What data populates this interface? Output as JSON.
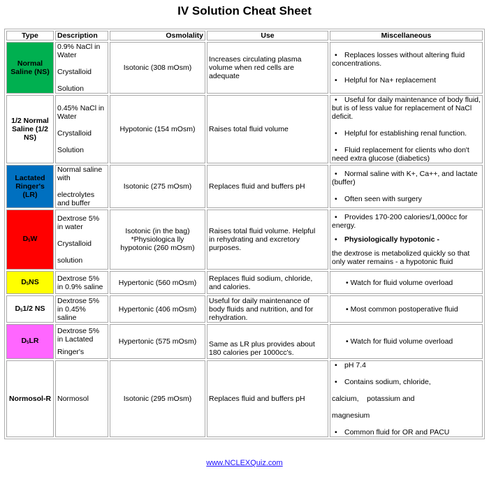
{
  "title": "IV Solution Cheat Sheet",
  "headers": {
    "type": "Type",
    "description": "Description",
    "osmolality": "Osmolality",
    "use": "Use",
    "misc": "Miscellaneous"
  },
  "colors": {
    "ns": "#00b050",
    "lr": "#0070c0",
    "d5w": "#ff0000",
    "d5ns": "#ffff00",
    "d5lr": "#ff66ff",
    "link": "#1a0dff"
  },
  "rows": [
    {
      "type": "Normal Saline (NS)",
      "description": [
        "0.9% NaCl in Water",
        "Crystalloid",
        "Solution"
      ],
      "osmolality": "Isotonic (308 mOsm)",
      "use": "Increases circulating plasma volume when red cells are adequate",
      "misc": [
        "Replaces losses without altering fluid concentrations.",
        "Helpful for Na+ replacement"
      ]
    },
    {
      "type": "1/2 Normal Saline (1/2 NS)",
      "description": [
        "0.45% NaCl in Water",
        "Crystalloid",
        "Solution"
      ],
      "osmolality": "Hypotonic (154 mOsm)",
      "use": "Raises total fluid volume",
      "misc": [
        "Useful for daily maintenance of body fluid, but is of less value for replacement of NaCl deficit.",
        "Helpful for establishing renal function.",
        "Fluid replacement for clients who don't need extra glucose (diabetics)"
      ]
    },
    {
      "type": "Lactated Ringer's (LR)",
      "description": [
        "Normal saline with",
        "electrolytes and buffer"
      ],
      "osmolality": "Isotonic (275 mOsm)",
      "use": "Replaces fluid and buffers pH",
      "misc": [
        "Normal saline with K+, Ca++, and lactate (buffer)",
        "Often seen with surgery"
      ]
    },
    {
      "type_prefix": "D",
      "type_sub": "5",
      "type_suffix": "W",
      "description": [
        "Dextrose 5% in water",
        "Crystalloid",
        "solution"
      ],
      "osmolality": "Isotonic (in the bag) *Physiologica lly hypotonic (260 mOsm)",
      "use": "Raises total fluid volume. Helpful in rehydrating and excretory purposes.",
      "misc": [
        "Provides 170-200 calories/1,000cc for energy.",
        "Physiologically hypotonic -",
        "the dextrose is metabolized quickly so that only water remains - a hypotonic fluid"
      ]
    },
    {
      "type_prefix": "D",
      "type_sub": "5",
      "type_suffix": "NS",
      "description": [
        "Dextrose 5% in 0.9% saline"
      ],
      "osmolality": "Hypertonic (560 mOsm)",
      "use": "Replaces fluid sodium, chloride, and calories.",
      "misc": [
        "• Watch for fluid volume overload"
      ]
    },
    {
      "type_prefix": "D",
      "type_sub": "5",
      "type_suffix": "1/2 NS",
      "description": [
        "Dextrose 5% in 0.45% saline"
      ],
      "osmolality": "Hypertonic (406 mOsm)",
      "use": "Useful for daily maintenance of body fluids and nutrition, and for rehydration.",
      "misc": [
        "• Most common postoperative fluid"
      ]
    },
    {
      "type_prefix": "D",
      "type_sub": "5",
      "type_suffix": "LR",
      "description": [
        "Dextrose 5% in Lactated",
        "Ringer's"
      ],
      "osmolality": "Hypertonic (575 mOsm)",
      "use": "Same as LR plus provides about 180 calories per 1000cc's.",
      "misc": [
        "• Watch for fluid volume overload"
      ]
    },
    {
      "type": "Normosol-R",
      "description": [
        "Normosol"
      ],
      "osmolality": "Isotonic (295 mOsm)",
      "use": "Replaces fluid and buffers pH",
      "misc": [
        "pH 7.4",
        "Contains sodium, chloride,",
        "calcium,    potassium and",
        "magnesium",
        "Common fluid for OR and PACU"
      ]
    }
  ],
  "footer": {
    "link_text": "www.NCLEXQuiz.com"
  }
}
